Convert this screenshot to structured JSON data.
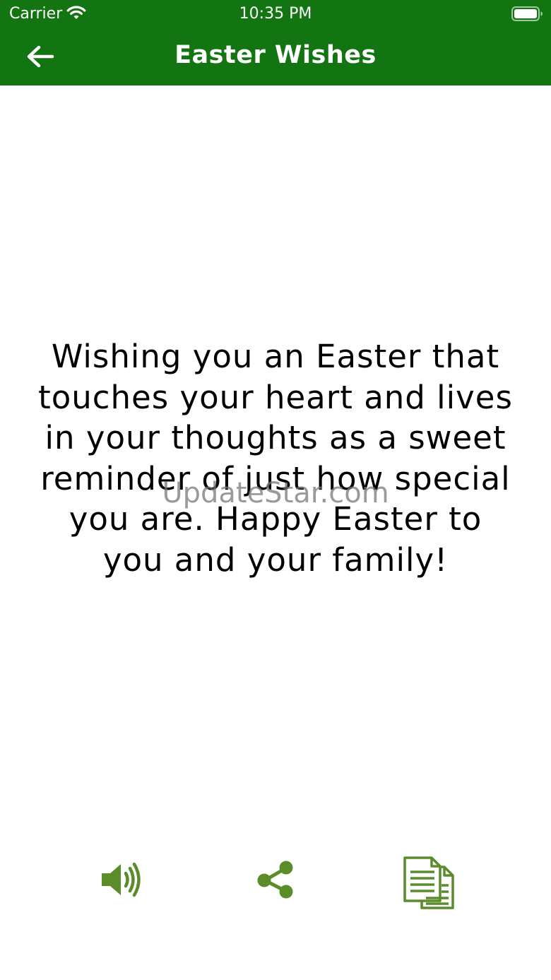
{
  "status_bar": {
    "carrier": "Carrier",
    "time": "10:35 PM"
  },
  "nav": {
    "title": "Easter Wishes",
    "back_icon": "arrow-left-icon"
  },
  "wish": {
    "text": "Wishing you an Easter that\ntouches your heart and lives\nin your thoughts as a sweet\nreminder of just how special\nyou are.  Happy Easter to\nyou and your family!"
  },
  "watermark": "UpdateStar.com",
  "actions": [
    {
      "icon": "speaker-icon"
    },
    {
      "icon": "share-icon"
    },
    {
      "icon": "copy-icon"
    }
  ],
  "colors": {
    "header_bg": "#127512",
    "accent_icon": "#5a8c2a",
    "text": "#000000"
  }
}
